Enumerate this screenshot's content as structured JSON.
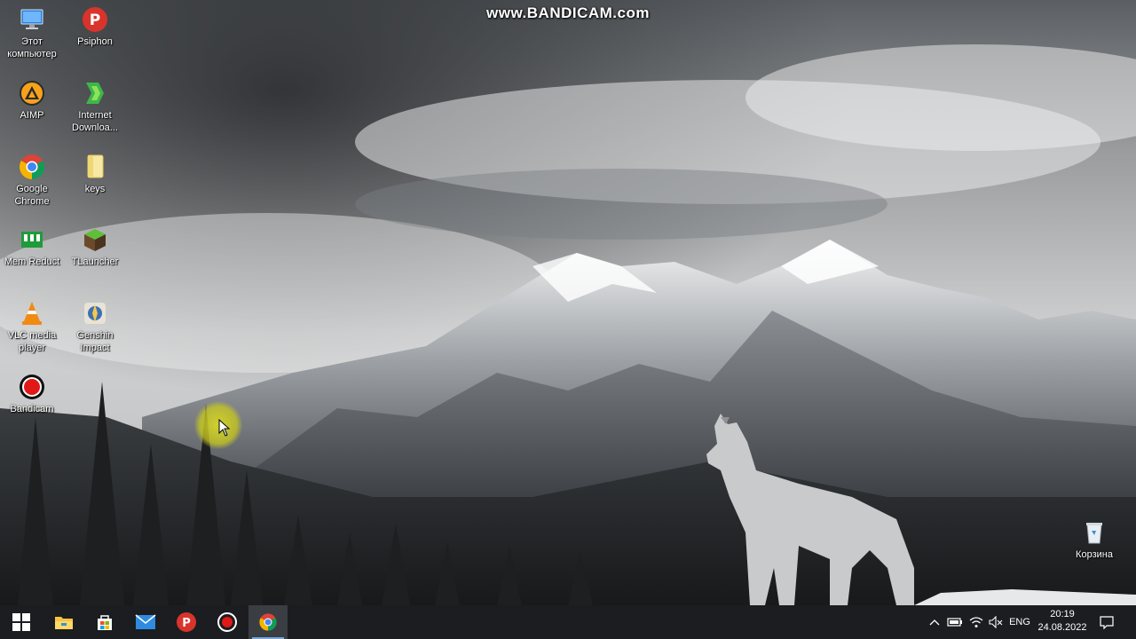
{
  "watermark": "www.BANDICAM.com",
  "desktop_icons": [
    {
      "id": "this-pc",
      "label": "Этот компьютер",
      "icon": "computer-icon"
    },
    {
      "id": "psiphon",
      "label": "Psiphon",
      "icon": "psiphon-icon"
    },
    {
      "id": "aimp",
      "label": "AIMP",
      "icon": "aimp-icon"
    },
    {
      "id": "internet-download",
      "label": "Internet Downloa...",
      "icon": "idm-icon"
    },
    {
      "id": "chrome",
      "label": "Google Chrome",
      "icon": "chrome-icon"
    },
    {
      "id": "keys",
      "label": "keys",
      "icon": "text-file-icon"
    },
    {
      "id": "mem-reduct",
      "label": "Mem Reduct",
      "icon": "mem-reduct-icon"
    },
    {
      "id": "tlauncher",
      "label": "TLauncher",
      "icon": "tlauncher-icon"
    },
    {
      "id": "vlc",
      "label": "VLC media player",
      "icon": "vlc-icon"
    },
    {
      "id": "genshin",
      "label": "Genshin Impact",
      "icon": "genshin-icon"
    },
    {
      "id": "bandicam",
      "label": "Bandicam",
      "icon": "bandicam-icon"
    },
    {
      "id": "recycle-bin",
      "label": "Корзина",
      "icon": "recycle-bin-icon"
    }
  ],
  "taskbar": {
    "apps": [
      {
        "id": "start",
        "icon": "windows-start-icon"
      },
      {
        "id": "explorer",
        "icon": "file-explorer-icon"
      },
      {
        "id": "store",
        "icon": "microsoft-store-icon"
      },
      {
        "id": "mail",
        "icon": "mail-icon"
      },
      {
        "id": "psiphon",
        "icon": "psiphon-icon"
      },
      {
        "id": "bandicam",
        "icon": "bandicam-record-icon"
      },
      {
        "id": "chrome",
        "icon": "chrome-icon",
        "active": true
      }
    ],
    "tray": {
      "language": "ENG",
      "time": "20:19",
      "date": "24.08.2022",
      "icons": [
        "chevron-up-icon",
        "battery-icon",
        "wifi-icon",
        "volume-muted-icon",
        "notification-icon"
      ]
    }
  },
  "colors": {
    "taskbar": "#1b1d20",
    "active_indicator": "#7aa7d6",
    "cursor_highlight": "#d6d628"
  }
}
